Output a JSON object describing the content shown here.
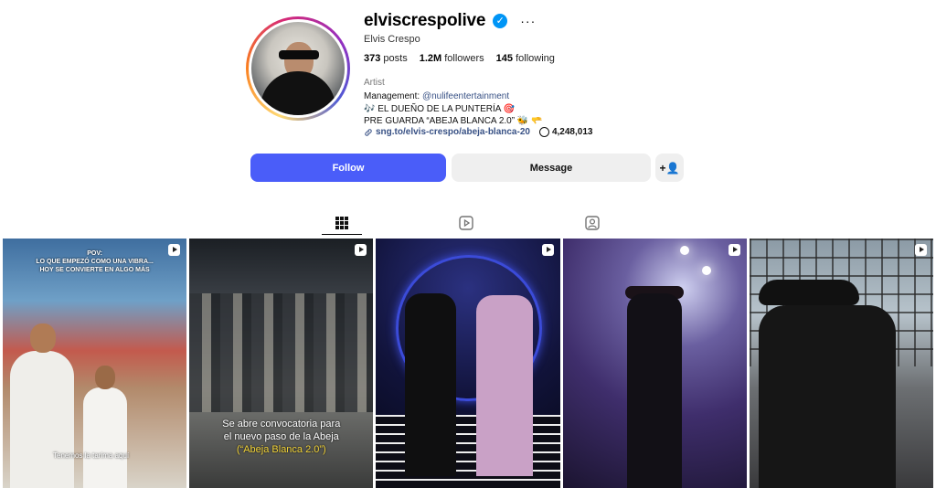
{
  "profile": {
    "username": "elviscrespolive",
    "more_label": "···",
    "full_name": "Elvis Crespo",
    "stats": {
      "posts_count": "373",
      "posts_label": "posts",
      "followers_count": "1.2M",
      "followers_label": "followers",
      "following_count": "145",
      "following_label": "following"
    },
    "category": "Artist",
    "bio": {
      "management_prefix": "Management:",
      "management_handle": "@nulifeentertainment",
      "line2": "🎶 EL DUEÑO DE LA PUNTERÍA 🎯",
      "line3": "PRE GUARDA “ABEJA BLANCA 2.0” 🐝 🫳"
    },
    "link": "sng.to/elvis-crespo/abeja-blanca-20",
    "threads_count": "4,248,013"
  },
  "actions": {
    "follow_label": "Follow",
    "message_label": "Message",
    "suggest_label": "+👤"
  },
  "tabs": [
    {
      "name": "posts",
      "icon": "grid-icon",
      "active": true
    },
    {
      "name": "reels",
      "icon": "reels-icon",
      "active": false
    },
    {
      "name": "tagged",
      "icon": "tagged-icon",
      "active": false
    }
  ],
  "posts": [
    {
      "overlay_lines": [
        "POV:",
        "LO QUE EMPEZÓ COMO UNA VIBRA...",
        "HOY SE CONVIERTE EN ALGO MÁS"
      ],
      "subtitle": "Tenemos la tarima aquí"
    },
    {
      "caption_line1": "Se abre convocatoria para",
      "caption_line2": "el nuevo paso de la Abeja",
      "caption_highlight": "(“Abeja Blanca 2.0”)"
    },
    {},
    {},
    {}
  ]
}
